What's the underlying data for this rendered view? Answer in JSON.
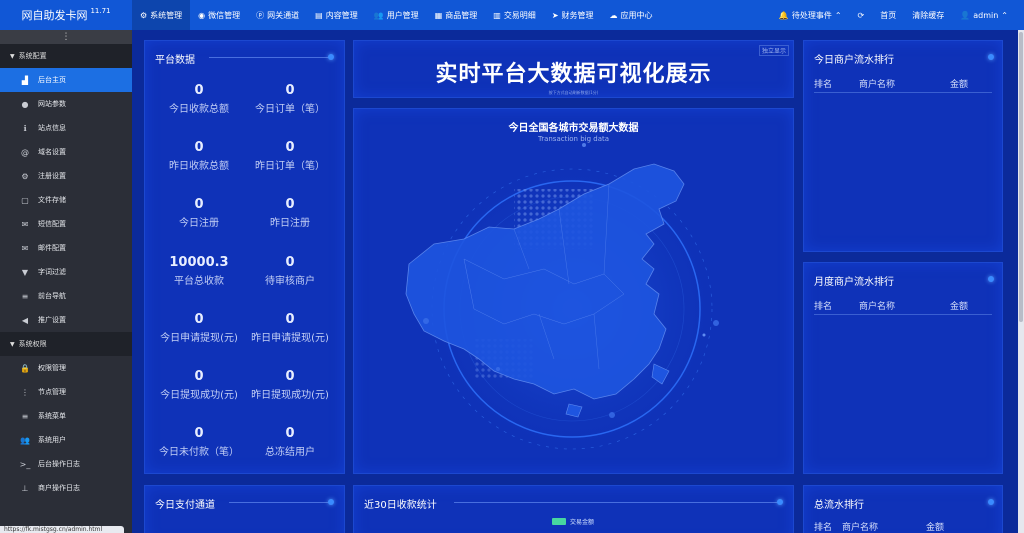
{
  "brand": {
    "name": "网自助发卡网",
    "version": "11.71"
  },
  "topnav": [
    {
      "icon": "⚙",
      "label": "系统管理",
      "active": true
    },
    {
      "icon": "◉",
      "label": "微信管理"
    },
    {
      "icon": "ⓟ",
      "label": "网关通道"
    },
    {
      "icon": "▤",
      "label": "内容管理"
    },
    {
      "icon": "👥",
      "label": "用户管理"
    },
    {
      "icon": "▦",
      "label": "商品管理"
    },
    {
      "icon": "▥",
      "label": "交易明细"
    },
    {
      "icon": "➤",
      "label": "财务管理"
    },
    {
      "icon": "☁",
      "label": "应用中心"
    }
  ],
  "topright": {
    "pending": "待处理事件",
    "refresh_icon": "⟳",
    "home": "首页",
    "clear_cache": "清除缓存",
    "user": "admin"
  },
  "sidebar": {
    "toggle": "⋮",
    "groups": [
      {
        "label": "系统配置",
        "items": [
          {
            "icon": "▟",
            "label": "后台主页",
            "active": true
          },
          {
            "icon": "●",
            "label": "网站参数"
          },
          {
            "icon": "ℹ",
            "label": "站点信息"
          },
          {
            "icon": "@",
            "label": "域名设置"
          },
          {
            "icon": "⚙",
            "label": "注册设置"
          },
          {
            "icon": "▢",
            "label": "文件存储"
          },
          {
            "icon": "✉",
            "label": "短信配置"
          },
          {
            "icon": "✉",
            "label": "邮件配置"
          },
          {
            "icon": "▼",
            "label": "字词过滤"
          },
          {
            "icon": "≡",
            "label": "前台导航"
          },
          {
            "icon": "◀",
            "label": "推广设置"
          }
        ]
      },
      {
        "label": "系统权限",
        "items": [
          {
            "icon": "🔒",
            "label": "权限管理"
          },
          {
            "icon": "⋮",
            "label": "节点管理"
          },
          {
            "icon": "≡",
            "label": "系统菜单"
          },
          {
            "icon": "👥",
            "label": "系统用户"
          },
          {
            "icon": ">_",
            "label": "后台操作日志"
          },
          {
            "icon": "⊥",
            "label": "商户操作日志"
          }
        ]
      }
    ],
    "status_url": "https://fk.mistgsg.cn/admin.html"
  },
  "platform": {
    "title": "平台数据",
    "stats": [
      {
        "value": "0",
        "label": "今日收款总额"
      },
      {
        "value": "0",
        "label": "今日订单（笔）"
      },
      {
        "value": "0",
        "label": "昨日收款总额"
      },
      {
        "value": "0",
        "label": "昨日订单（笔）"
      },
      {
        "value": "0",
        "label": "今日注册"
      },
      {
        "value": "0",
        "label": "昨日注册"
      },
      {
        "value": "10000.3",
        "label": "平台总收款"
      },
      {
        "value": "0",
        "label": "待审核商户"
      },
      {
        "value": "0",
        "label": "今日申请提现(元)"
      },
      {
        "value": "0",
        "label": "昨日申请提现(元)"
      },
      {
        "value": "0",
        "label": "今日提现成功(元)"
      },
      {
        "value": "0",
        "label": "昨日提现成功(元)"
      },
      {
        "value": "0",
        "label": "今日未付款（笔）"
      },
      {
        "value": "0",
        "label": "总冻结用户"
      }
    ]
  },
  "header_panel": {
    "title": "实时平台大数据可视化展示",
    "caption": "按下方式自动刷新数据(1分)",
    "button": "独立显示"
  },
  "map_panel": {
    "title": "今日全国各城市交易额大数据",
    "subtitle": "Transaction big data"
  },
  "ranking_today": {
    "title": "今日商户流水排行",
    "cols": [
      "排名",
      "商户名称",
      "金额"
    ]
  },
  "ranking_month": {
    "title": "月度商户流水排行",
    "cols": [
      "排名",
      "商户名称",
      "金额"
    ]
  },
  "ranking_total": {
    "title": "总流水排行",
    "cols": [
      "排名",
      "商户名称",
      "金额"
    ]
  },
  "channels": {
    "title": "今日支付通道"
  },
  "stats30": {
    "title": "近30日收款统计",
    "legend": "交易金额"
  },
  "colors": {
    "topbar": "#1157d6",
    "sidebar": "#2b2e37",
    "active": "#1c6fe3",
    "panel": "#0f32b8",
    "background": "#0b2a9a"
  }
}
